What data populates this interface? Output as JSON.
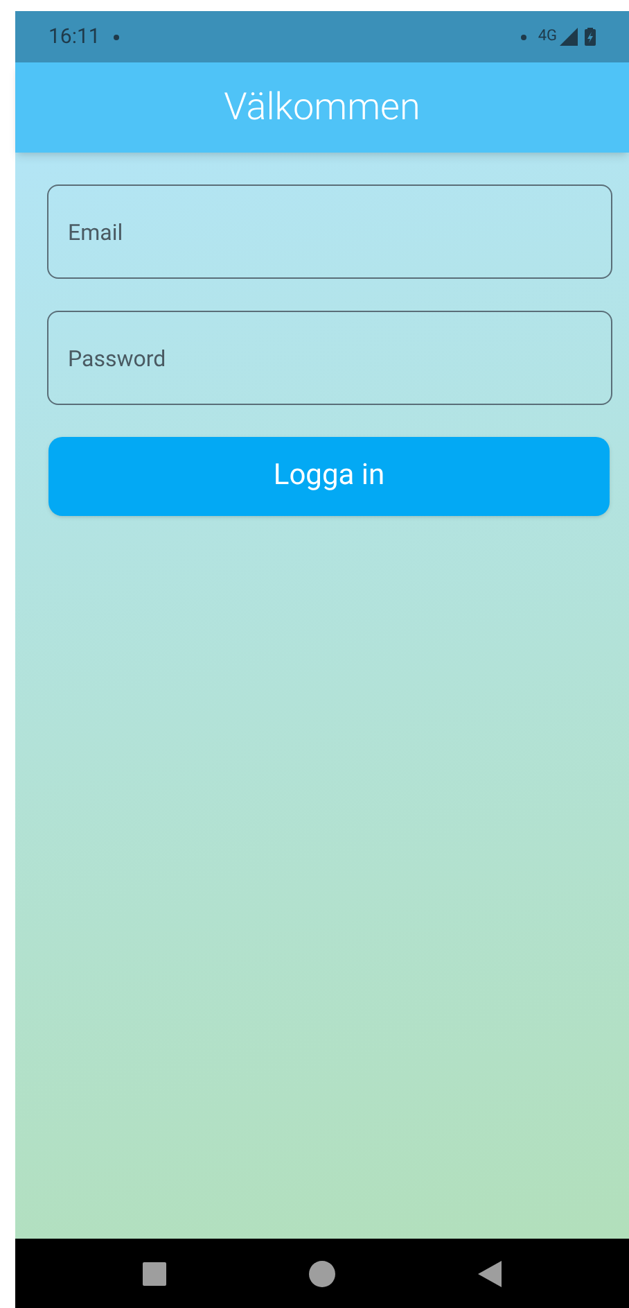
{
  "status_bar": {
    "time": "16:11",
    "network": "4G"
  },
  "app_bar": {
    "title": "Välkommen"
  },
  "form": {
    "email": {
      "placeholder": "Email"
    },
    "password": {
      "placeholder": "Password"
    },
    "login_button": "Logga in"
  }
}
